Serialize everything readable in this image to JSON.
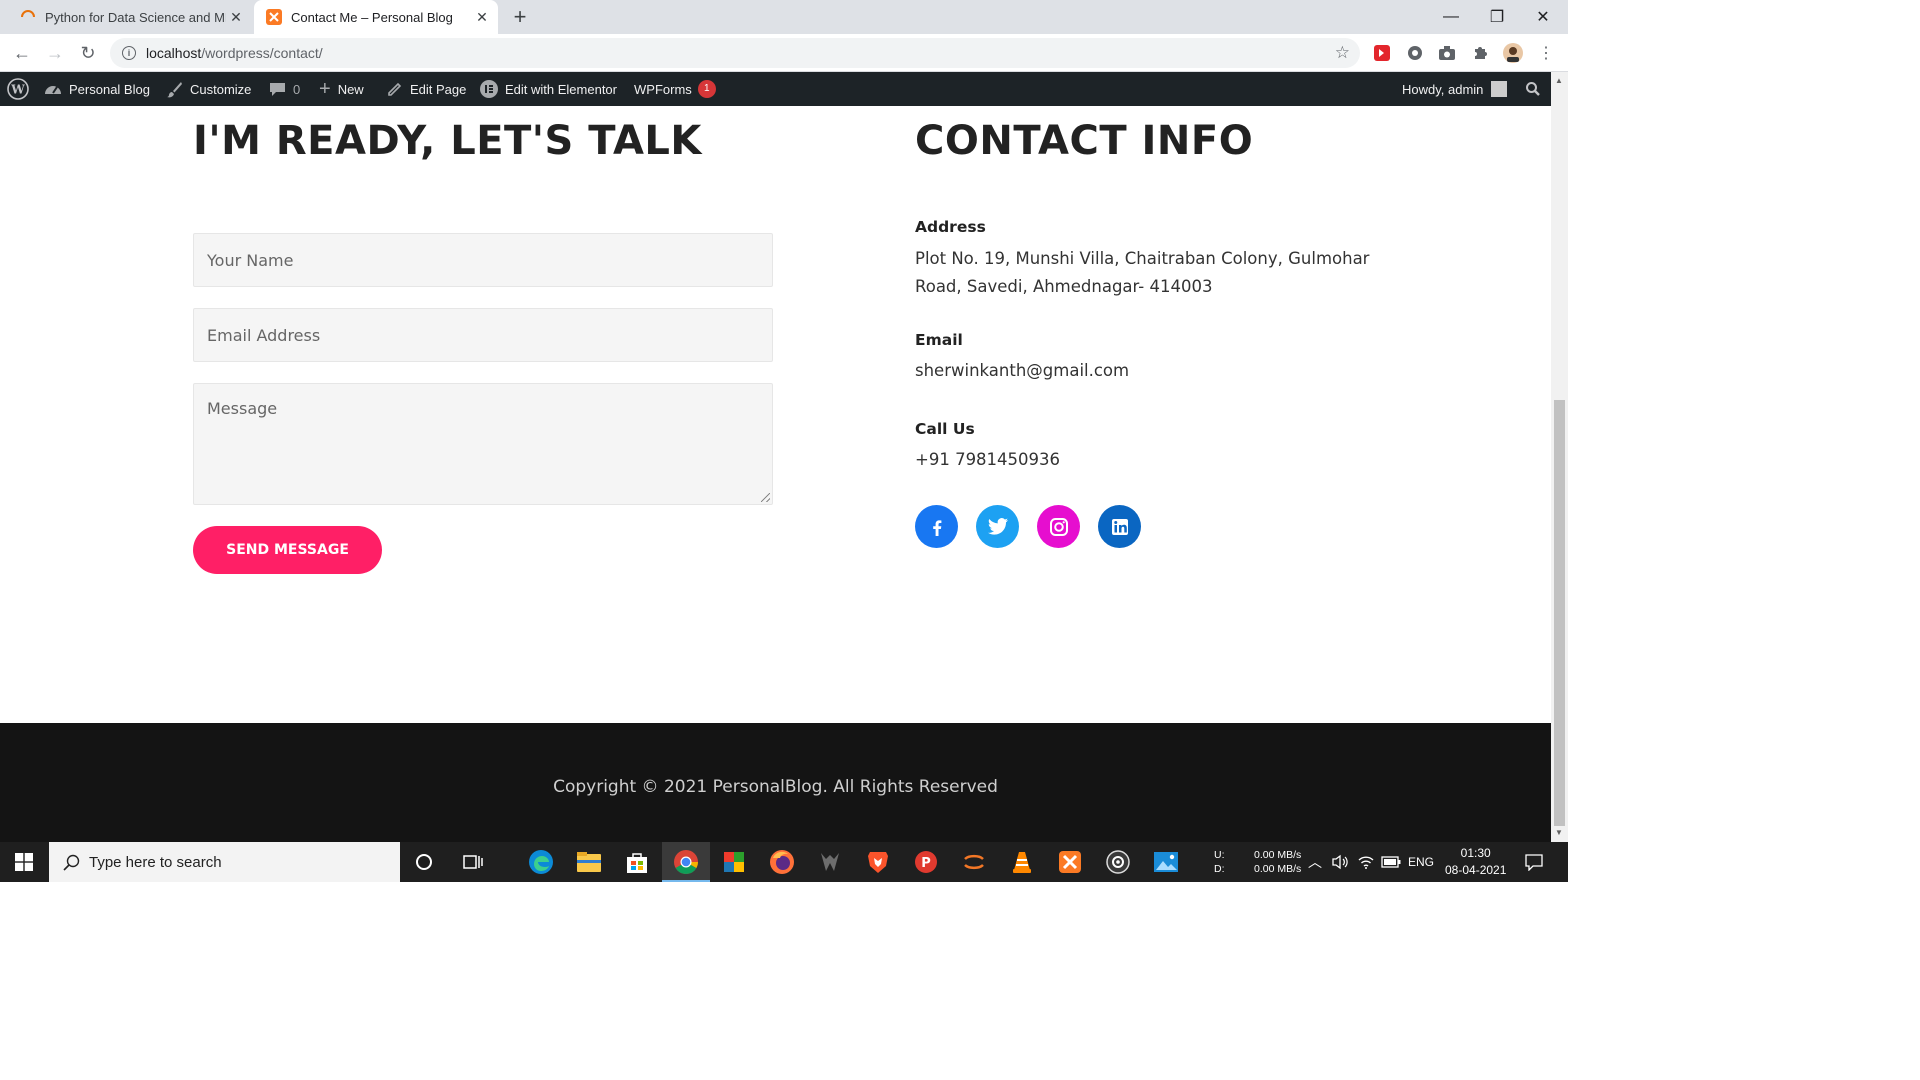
{
  "browser": {
    "tabs": [
      {
        "title": "Python for Data Science and ML/",
        "active": false
      },
      {
        "title": "Contact Me – Personal Blog",
        "active": true
      }
    ],
    "url_host": "localhost",
    "url_path": "/wordpress/contact/"
  },
  "admin_bar": {
    "site_name": "Personal Blog",
    "customize": "Customize",
    "comments_count": "0",
    "new": "New",
    "edit_page": "Edit Page",
    "edit_elementor": "Edit with Elementor",
    "wpforms": "WPForms",
    "wpforms_badge": "1",
    "howdy": "Howdy, admin"
  },
  "contact_form": {
    "heading": "I'M READY, LET'S TALK",
    "name_placeholder": "Your Name",
    "email_placeholder": "Email Address",
    "message_placeholder": "Message",
    "submit_label": "SEND MESSAGE",
    "accent_color": "#ff1f66"
  },
  "contact_info": {
    "heading": "CONTACT INFO",
    "address_label": "Address",
    "address_line1": "Plot No. 19, Munshi Villa, Chaitraban Colony, Gulmohar",
    "address_line2": "Road, Savedi, Ahmednagar- 414003",
    "email_label": "Email",
    "email_value": "sherwinkanth@gmail.com",
    "phone_label": "Call Us",
    "phone_value": "+91 7981450936",
    "social": [
      {
        "name": "facebook-icon",
        "color": "#1877f2"
      },
      {
        "name": "twitter-icon",
        "color": "#1da1f2"
      },
      {
        "name": "instagram-icon",
        "color": "#e60ecf"
      },
      {
        "name": "linkedin-icon",
        "color": "#0a66c2"
      }
    ]
  },
  "footer": {
    "copyright": "Copyright © 2021 PersonalBlog. All Rights Reserved"
  },
  "taskbar": {
    "search_placeholder": "Type here to search",
    "net_up_label": "U:",
    "net_down_label": "D:",
    "net_up": "0.00 MB/s",
    "net_down": "0.00 MB/s",
    "language": "ENG",
    "time": "01:30",
    "date": "08-04-2021"
  }
}
